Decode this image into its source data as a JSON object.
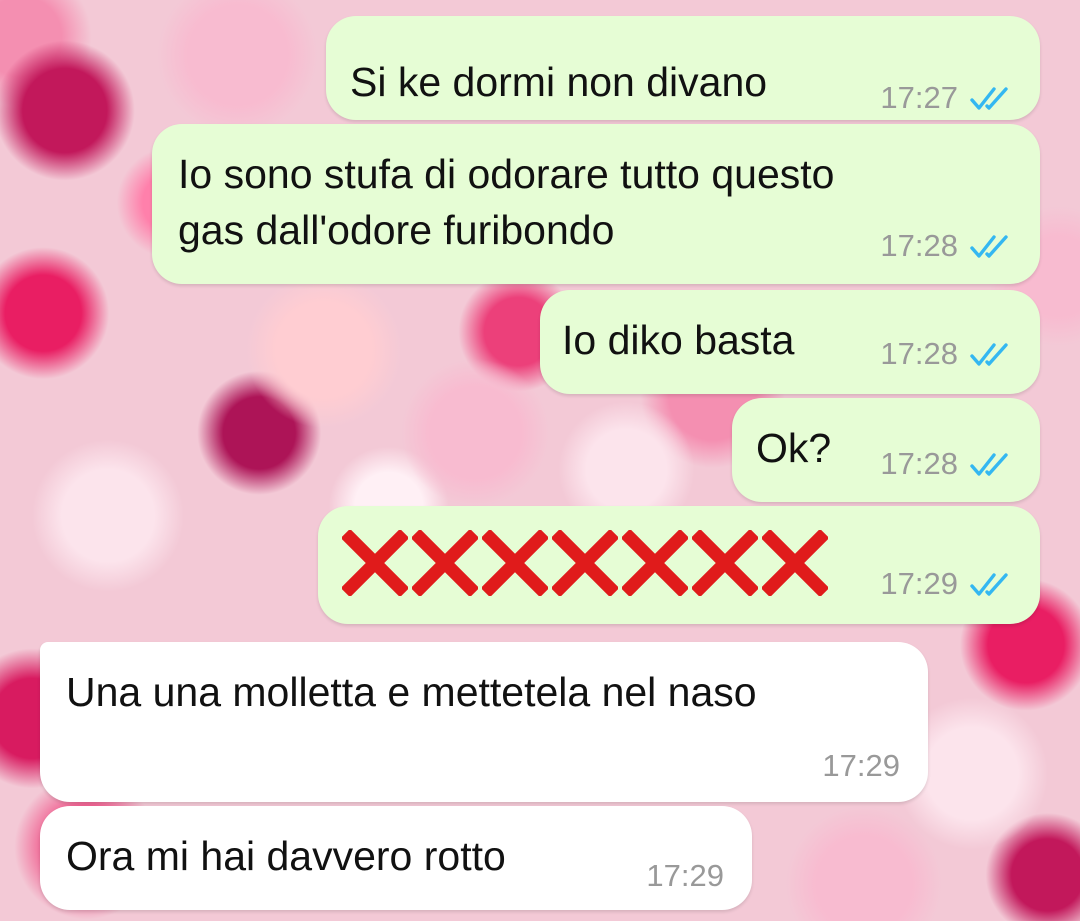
{
  "colors": {
    "outgoing_bubble": "#e6fdd5",
    "incoming_bubble": "#ffffff",
    "timestamp": "#999999",
    "read_ticks": "#34b7f1",
    "x_marks": "#e01b1b"
  },
  "icons": {
    "read_receipt": "double-check-icon",
    "cross": "red-x-icon"
  },
  "messages": [
    {
      "direction": "outgoing",
      "text": "Si ke dormi non divano",
      "time": "17:27",
      "status": "read"
    },
    {
      "direction": "outgoing",
      "text": "Io sono stufa di odorare tutto questo\ngas dall'odore furibondo",
      "time": "17:28",
      "status": "read"
    },
    {
      "direction": "outgoing",
      "text": "Io diko basta",
      "time": "17:28",
      "status": "read"
    },
    {
      "direction": "outgoing",
      "text": "Ok?",
      "time": "17:28",
      "status": "read"
    },
    {
      "direction": "outgoing",
      "emoji": "❌❌❌❌❌❌❌",
      "time": "17:29",
      "status": "read"
    },
    {
      "direction": "incoming",
      "text": "Una una molletta e mettetela nel naso",
      "time": "17:29"
    },
    {
      "direction": "incoming",
      "text": "Ora mi hai davvero rotto",
      "time": "17:29"
    }
  ]
}
